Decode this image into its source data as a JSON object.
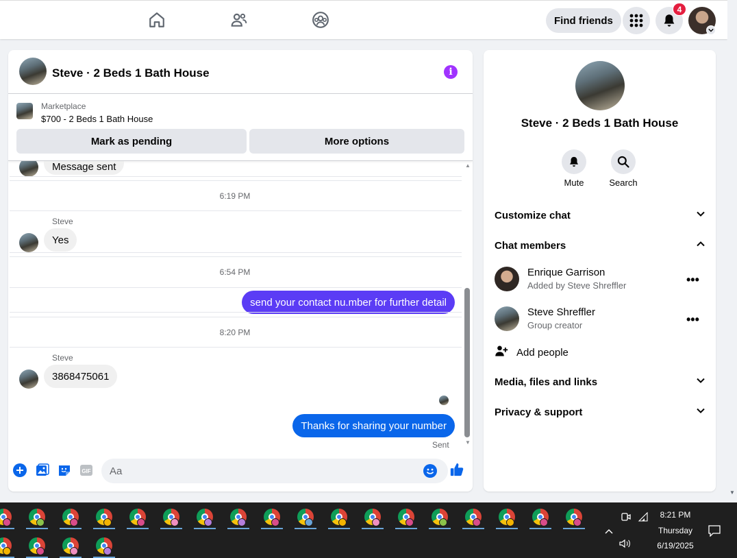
{
  "nav": {
    "find_friends": "Find friends",
    "notification_count": "4",
    "icons": [
      "home-icon",
      "friends-icon",
      "groups-icon",
      "menu-grid-icon",
      "bell-icon"
    ]
  },
  "chat": {
    "title": "Steve · 2 Beds 1 Bath House",
    "marketplace_label": "Marketplace",
    "listing": "$700 - 2 Beds 1 Bath House",
    "mark_pending": "Mark as pending",
    "more_options": "More options",
    "partial_message": "Message sent",
    "times": [
      "6:19 PM",
      "6:54 PM",
      "8:20 PM"
    ],
    "sender_name": "Steve",
    "msg_yes": "Yes",
    "msg_contact": "send your contact nu.mber for further detail",
    "msg_number": "3868475061",
    "msg_thanks": "Thanks for sharing your number",
    "sent": "Sent",
    "composer_placeholder": "Aa",
    "accent_purple": "#5b3cf5",
    "accent_blue": "#0a66ea"
  },
  "info": {
    "title": "Steve · 2 Beds 1 Bath House",
    "mute": "Mute",
    "search": "Search",
    "customize_chat": "Customize chat",
    "chat_members": "Chat members",
    "members": [
      {
        "name": "Enrique Garrison",
        "sub": "Added by Steve Shreffler"
      },
      {
        "name": "Steve Shreffler",
        "sub": "Group creator"
      }
    ],
    "add_people": "Add people",
    "media": "Media, files and links",
    "privacy": "Privacy & support"
  },
  "taskbar": {
    "time": "8:21 PM",
    "day": "Thursday",
    "date": "6/19/2025"
  }
}
